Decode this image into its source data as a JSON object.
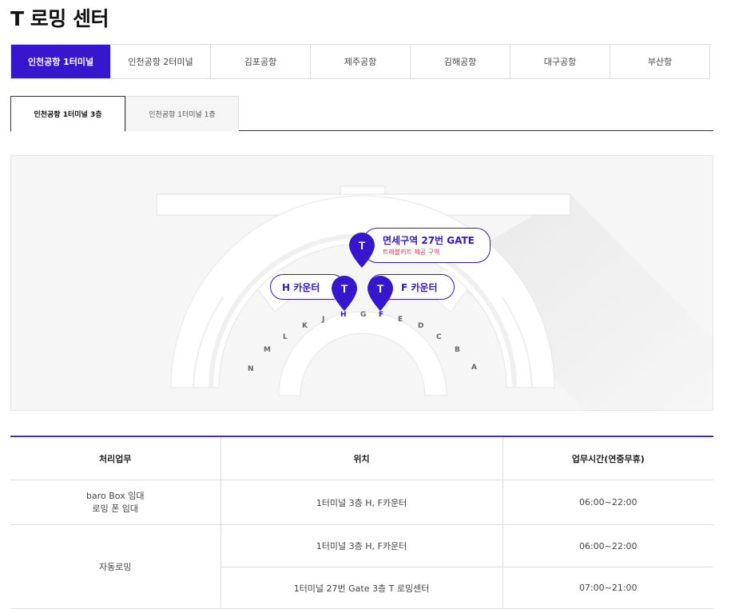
{
  "page": {
    "title": "T 로밍 센터"
  },
  "airport_tabs": [
    {
      "label": "인천공항 1터미널",
      "active": true
    },
    {
      "label": "인천공항 2터미널",
      "active": false
    },
    {
      "label": "김포공항",
      "active": false
    },
    {
      "label": "제주공항",
      "active": false
    },
    {
      "label": "김해공항",
      "active": false
    },
    {
      "label": "대구공항",
      "active": false
    },
    {
      "label": "부산항",
      "active": false
    }
  ],
  "floor_tabs": [
    {
      "label": "인천공항 1터미널 3층",
      "active": true
    },
    {
      "label": "인천공항 1터미널 1층",
      "active": false
    }
  ],
  "map": {
    "pin_glyph": "T",
    "gates": [
      "N",
      "M",
      "L",
      "K",
      "J",
      "H",
      "G",
      "F",
      "E",
      "D",
      "C",
      "B",
      "A"
    ],
    "highlighted_gates": [
      "H",
      "F"
    ],
    "callouts": {
      "duty_free": {
        "title": "면세구역 27번 GATE",
        "subtitle": "트래블키트 제공 구역"
      },
      "h_counter": {
        "title": "H 카운터"
      },
      "f_counter": {
        "title": "F 카운터"
      }
    },
    "accent_color": "#3617ce"
  },
  "table": {
    "headers": [
      "처리업무",
      "위치",
      "업무시간(연중무휴)"
    ],
    "rows": [
      {
        "task_lines": [
          "baro Box 임대",
          "로밍 폰 임대"
        ],
        "location": "1터미널 3층 H, F카운터",
        "hours": "06:00~22:00"
      },
      {
        "task_lines": [
          "자동로밍"
        ],
        "location": "1터미널 3층 H, F카운터",
        "hours": "06:00~22:00"
      },
      {
        "location": "1터미널 27번 Gate 3층 T 로밍센터",
        "hours": "07:00~21:00"
      }
    ]
  }
}
